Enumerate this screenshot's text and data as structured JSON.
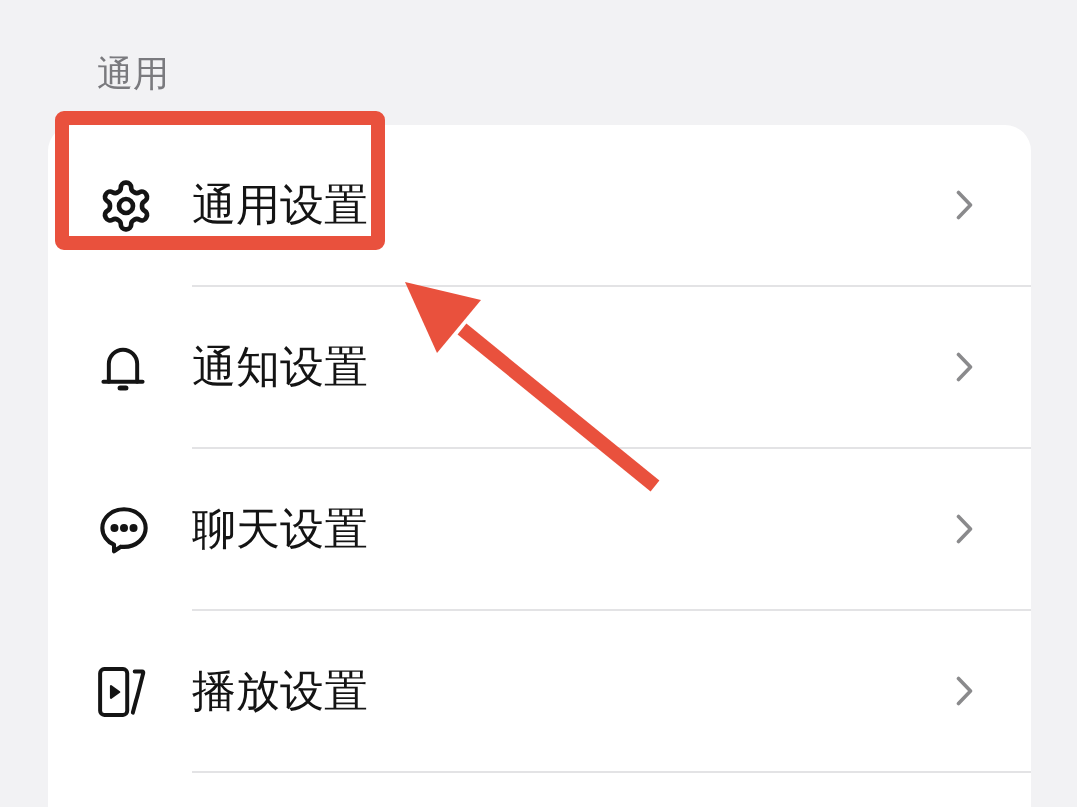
{
  "section": {
    "title": "通用"
  },
  "items": [
    {
      "label": "通用设置",
      "highlighted": true
    },
    {
      "label": "通知设置",
      "highlighted": false
    },
    {
      "label": "聊天设置",
      "highlighted": false
    },
    {
      "label": "播放设置",
      "highlighted": false
    }
  ]
}
